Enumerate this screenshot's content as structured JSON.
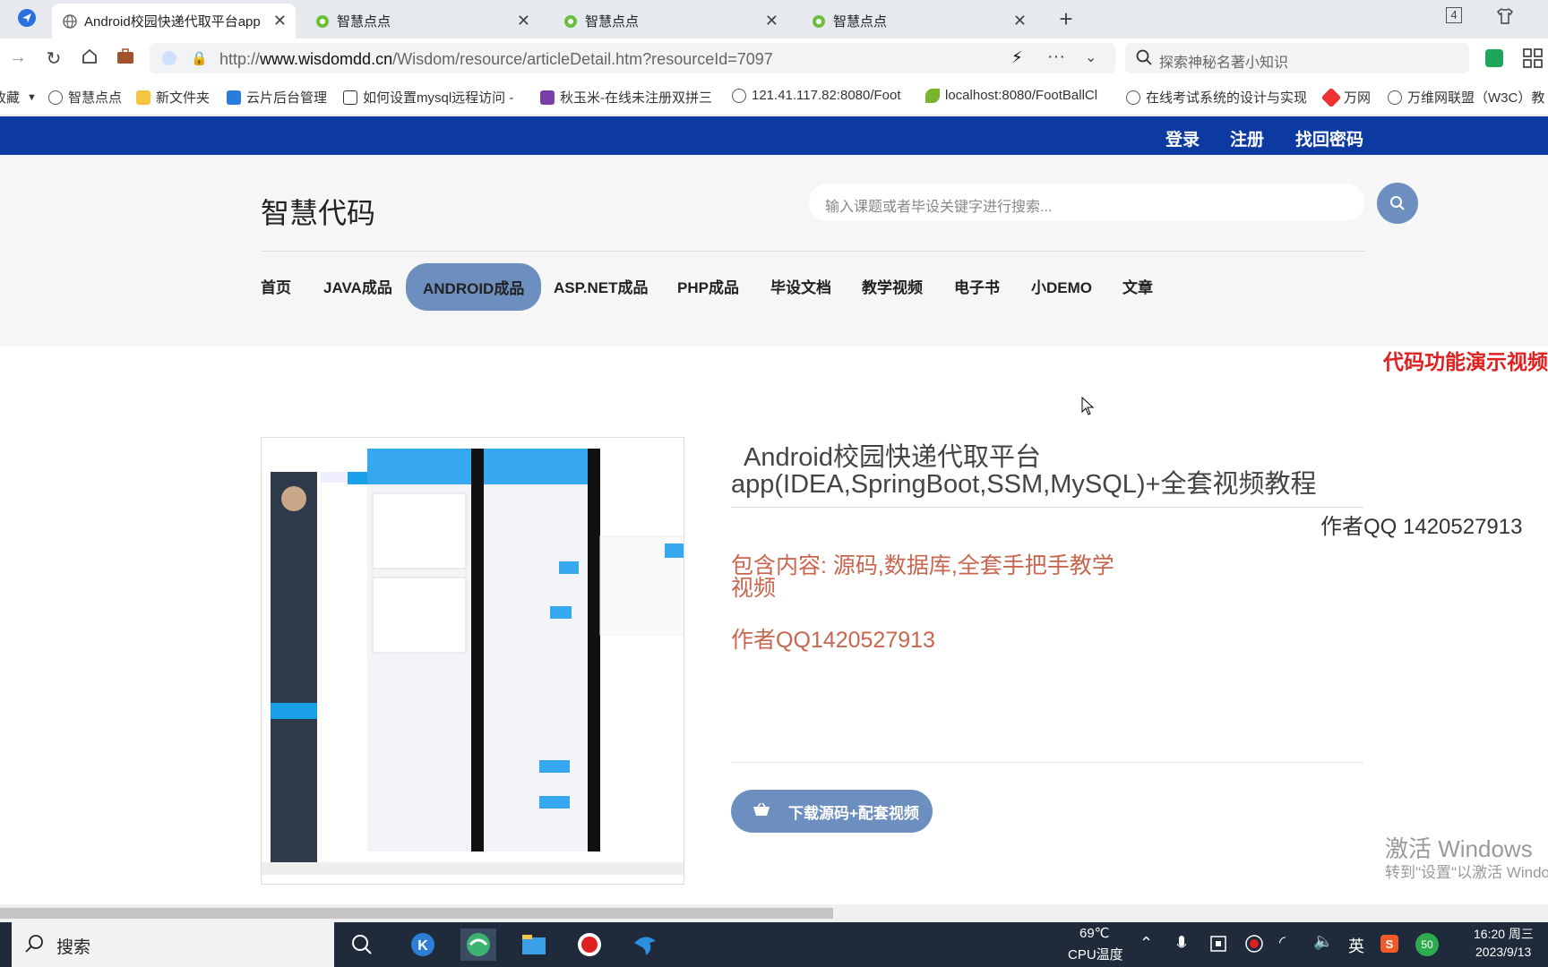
{
  "browser": {
    "tabs": [
      {
        "title": "Android校园快递代取平台app",
        "active": true
      },
      {
        "title": "智慧点点",
        "active": false
      },
      {
        "title": "智慧点点",
        "active": false
      },
      {
        "title": "智慧点点",
        "active": false
      }
    ],
    "tab_count_badge": "4",
    "url_prefix": "http://",
    "url_domain": "www.wisdomdd.cn",
    "url_path": "/Wisdom/resource/articleDetail.htm?resourceId=7097",
    "search_placeholder": "探索神秘名著小知识",
    "bookmarks": [
      "收藏",
      "智慧点点",
      "新文件夹",
      "云片后台管理",
      "如何设置mysql远程访问 -",
      "秋玉米-在线未注册双拼三",
      "121.41.117.82:8080/Foot",
      "localhost:8080/FootBallCl",
      "在线考试系统的设计与实现",
      "万网",
      "万维网联盟（W3C）教"
    ]
  },
  "site": {
    "top_links": {
      "login": "登录",
      "register": "注册",
      "recover": "找回密码"
    },
    "logo": "智慧代码",
    "search_placeholder": "输入课题或者毕设关键字进行搜索...",
    "menu": [
      "首页",
      "JAVA成品",
      "ANDROID成品",
      "ASP.NET成品",
      "PHP成品",
      "毕设文档",
      "教学视频",
      "电子书",
      "小DEMO",
      "文章"
    ],
    "active_menu": "ANDROID成品",
    "marquee": "代码功能演示视频",
    "product": {
      "title_line1": "Android校园快递代取平台",
      "title_line2": "app(IDEA,SpringBoot,SSM,MySQL)+全套视频教程",
      "author_qq": "作者QQ 1420527913",
      "contents_line1": "包含内容: 源码,数据库,全套手把手教学",
      "contents_line2": "视频",
      "author_qq2": "作者QQ1420527913",
      "download_button": "下载源码+配套视频"
    },
    "windows_watermark": {
      "line1": "激活 Windows",
      "line2": "转到\"设置\"以激活 Windows。"
    }
  },
  "taskbar": {
    "search_label": "搜索",
    "temp": "69℃",
    "temp_label": "CPU温度",
    "ime": "英",
    "badge": "50",
    "time": "16:20 周三",
    "date": "2023/9/13"
  },
  "colors": {
    "topbar": "#0d3aa0",
    "accent": "#6d8fbf",
    "marquee": "#e02020",
    "product_text": "#c9664f"
  }
}
